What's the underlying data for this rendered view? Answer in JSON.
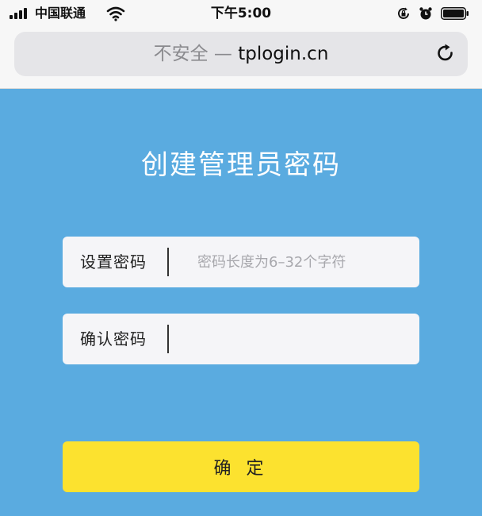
{
  "status_bar": {
    "carrier": "中国联通",
    "time": "下午5:00",
    "icons": [
      "signal-icon",
      "wifi-icon",
      "rotation-lock-icon",
      "alarm-icon",
      "battery-icon"
    ]
  },
  "browser": {
    "insecure_label": "不安全 — ",
    "domain": "tplogin.cn",
    "reload_icon": "reload-icon"
  },
  "form": {
    "title": "创建管理员密码",
    "password": {
      "label": "设置密码",
      "placeholder": "密码长度为6–32个字符",
      "value": ""
    },
    "confirm_password": {
      "label": "确认密码",
      "placeholder": "",
      "value": ""
    },
    "submit_label": "确 定"
  },
  "colors": {
    "page_background": "#5aabe0",
    "field_background": "#f5f5f8",
    "button_background": "#fce22f",
    "title_text": "#ffffff"
  }
}
